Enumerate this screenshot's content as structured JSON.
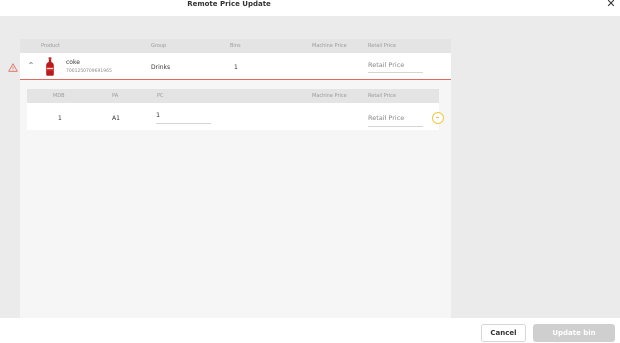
{
  "header": {
    "title": "Remote Price Update",
    "close_icon": "close-icon"
  },
  "columns": {
    "product": "Product",
    "group": "Group",
    "bins": "Bins",
    "machine_price": "Machine Price",
    "retail_price": "Retail Price"
  },
  "product_row": {
    "name": "coke",
    "code": "7001250709691965",
    "group": "Drinks",
    "bins": "1",
    "machine_price": "",
    "retail_placeholder": "Retail Price",
    "retail_value": ""
  },
  "sub_columns": {
    "mdb": "MDB",
    "pa": "PA",
    "pc": "PC",
    "machine_price": "Machine Price",
    "retail_price": "Retail Price"
  },
  "sub_row": {
    "mdb": "1",
    "pa": "A1",
    "pc": "1",
    "machine_price": "",
    "retail_placeholder": "Retail Price",
    "retail_value": ""
  },
  "footer": {
    "cancel": "Cancel",
    "update": "Update bin"
  },
  "colors": {
    "warning": "#e06a60",
    "remove_accent": "#f0c840",
    "disabled_button": "#cfcfcf"
  }
}
